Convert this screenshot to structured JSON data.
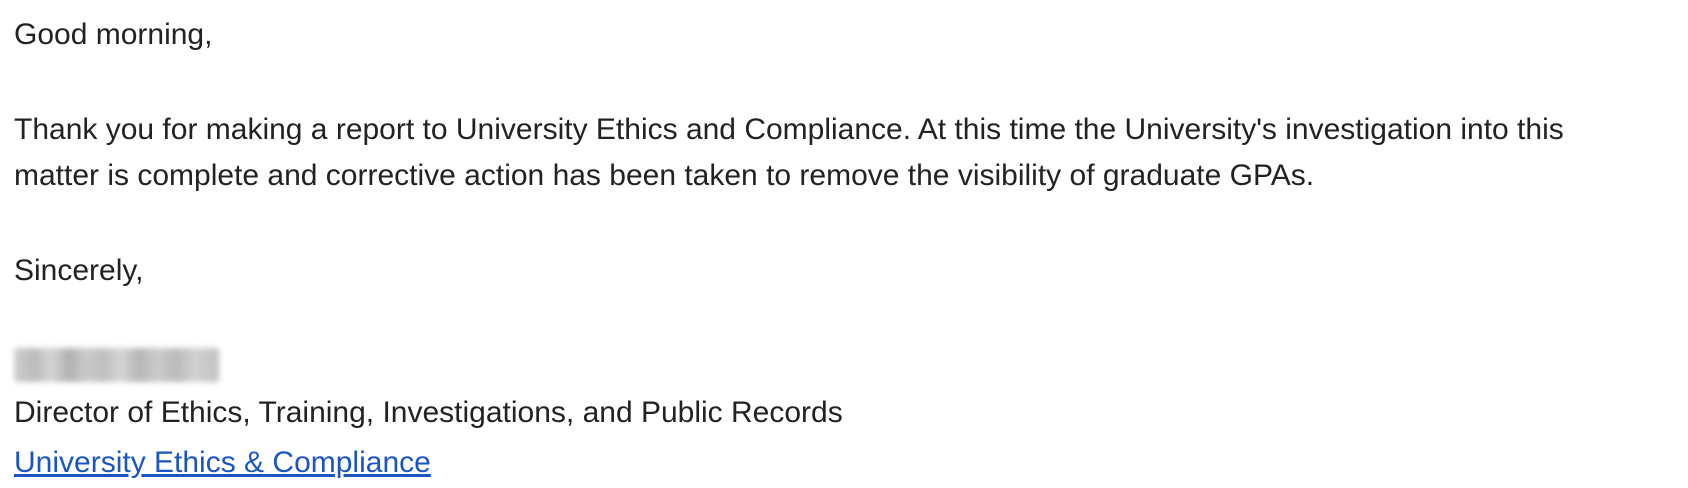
{
  "email": {
    "greeting": "Good morning,",
    "paragraph_line1": "Thank you for making a report to University Ethics and Compliance. At this time the University's investigation into this",
    "paragraph_line2": "matter is complete and corrective action has been taken to remove the visibility of graduate GPAs.",
    "closing": "Sincerely,",
    "signature": {
      "title": "Director of Ethics, Training, Investigations, and Public Records",
      "link_text": "University Ethics & Compliance"
    }
  },
  "colors": {
    "text": "#222222",
    "link": "#1a55c4",
    "background": "#ffffff"
  }
}
